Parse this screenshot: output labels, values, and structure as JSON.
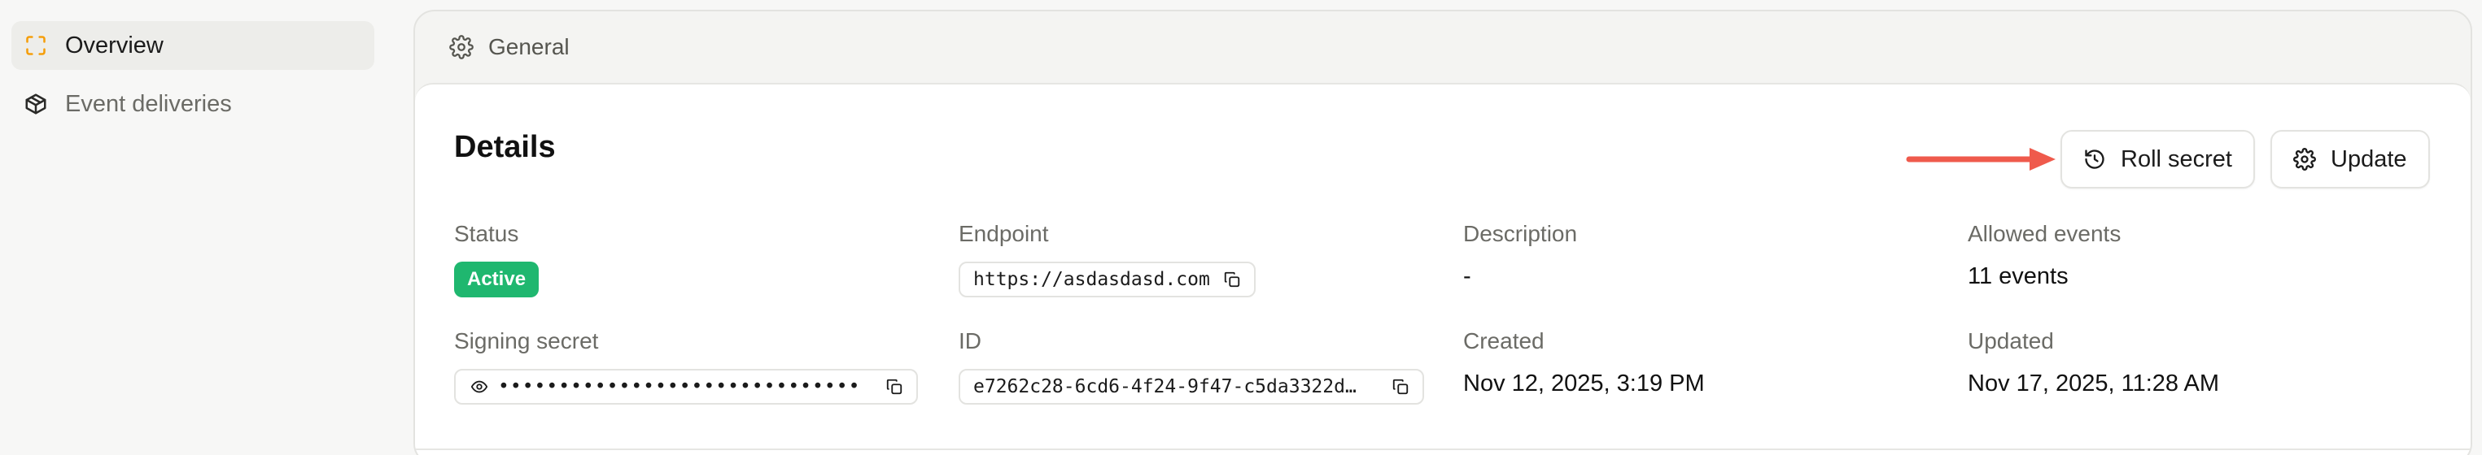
{
  "sidebar": {
    "items": [
      {
        "label": "Overview",
        "icon": "scan-icon",
        "active": true
      },
      {
        "label": "Event deliveries",
        "icon": "package-icon",
        "active": false
      }
    ]
  },
  "panel": {
    "section_label": "General",
    "section_icon": "gear-icon"
  },
  "details": {
    "title": "Details",
    "buttons": {
      "roll_secret": "Roll secret",
      "update": "Update"
    },
    "fields": {
      "status": {
        "label": "Status",
        "value": "Active"
      },
      "endpoint": {
        "label": "Endpoint",
        "value": "https://asdasdasd.com"
      },
      "description": {
        "label": "Description",
        "value": "-"
      },
      "allowed_events": {
        "label": "Allowed events",
        "value": "11 events"
      },
      "signing_secret": {
        "label": "Signing secret",
        "value": "••••••••••••••••••••••••••••••"
      },
      "id": {
        "label": "ID",
        "value": "e7262c28-6cd6-4f24-9f47-c5da3322d…"
      },
      "created": {
        "label": "Created",
        "value": "Nov 12, 2025, 3:19 PM"
      },
      "updated": {
        "label": "Updated",
        "value": "Nov 17, 2025, 11:28 AM"
      }
    }
  },
  "colors": {
    "accent_orange": "#f59e0b",
    "status_green": "#1fb76f",
    "arrow_red": "#ef5a4c"
  }
}
